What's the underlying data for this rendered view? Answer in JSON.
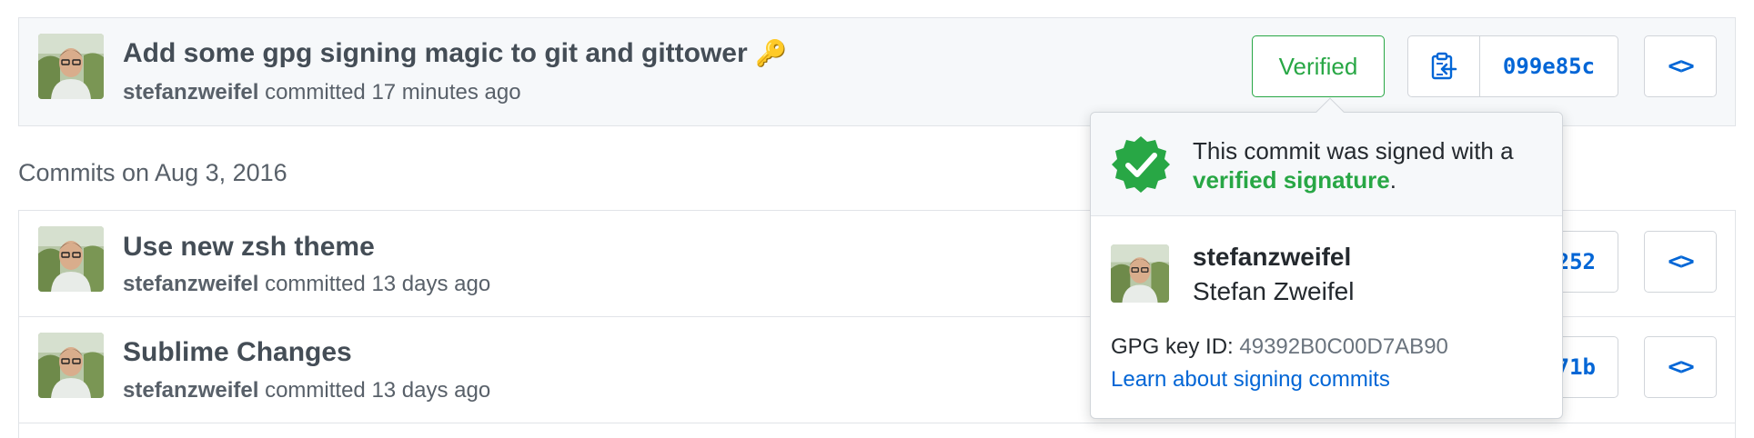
{
  "commits": [
    {
      "title": "Add some gpg signing magic to git and gittower",
      "emoji": "🔑",
      "author": "stefanzweifel",
      "action": "committed",
      "time": "17 minutes ago",
      "status": "Verified",
      "sha": "099e85c"
    },
    {
      "title": "Use new zsh theme",
      "author": "stefanzweifel",
      "action": "committed",
      "time": "13 days ago",
      "sha_partial": "252"
    },
    {
      "title": "Sublime Changes",
      "author": "stefanzweifel",
      "action": "committed",
      "time": "13 days ago",
      "sha_partial": "71b"
    }
  ],
  "date_heading": "Commits on Aug 3, 2016",
  "popover": {
    "message_prefix": "This commit was signed with a",
    "message_link": "verified signature",
    "message_suffix": ".",
    "username": "stefanzweifel",
    "full_name": "Stefan Zweifel",
    "key_label": "GPG key ID:",
    "key_id": "49392B0C00D7AB90",
    "learn_link": "Learn about signing commits"
  },
  "icons": {
    "copy": "clipboard-icon",
    "browse": "code-icon",
    "verified": "verified-badge-icon"
  },
  "colors": {
    "accent": "#0366d6",
    "verified": "#28a745"
  }
}
